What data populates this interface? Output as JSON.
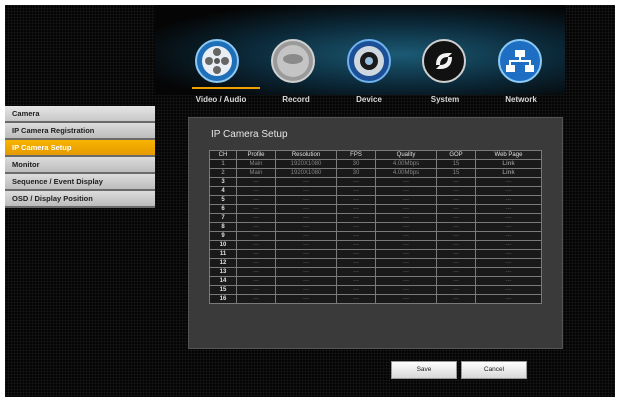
{
  "nav": {
    "tabs": [
      {
        "label": "Video / Audio",
        "icon": "film-reel-icon",
        "active": true
      },
      {
        "label": "Record",
        "icon": "record-disc-icon"
      },
      {
        "label": "Device",
        "icon": "device-dial-icon"
      },
      {
        "label": "System",
        "icon": "system-swirl-icon"
      },
      {
        "label": "Network",
        "icon": "network-icon"
      }
    ]
  },
  "sidebar": {
    "items": [
      {
        "label": "Camera"
      },
      {
        "label": "IP Camera Registration"
      },
      {
        "label": "IP Camera Setup",
        "active": true
      },
      {
        "label": "Monitor"
      },
      {
        "label": "Sequence / Event Display"
      },
      {
        "label": "OSD / Display Position"
      }
    ]
  },
  "panel": {
    "title": "IP Camera Setup",
    "columns": [
      "CH",
      "Profile",
      "Resolution",
      "FPS",
      "Quality",
      "GOP",
      "Web Page"
    ],
    "rows": [
      [
        "1",
        "Main",
        "1920X1080",
        "30",
        "4.00Mbps",
        "15",
        "Link"
      ],
      [
        "2",
        "Main",
        "1920X1080",
        "30",
        "4.00Mbps",
        "15",
        "Link"
      ],
      [
        "3",
        "---",
        "---",
        "---",
        "---",
        "---",
        "---"
      ],
      [
        "4",
        "---",
        "---",
        "---",
        "---",
        "---",
        "---"
      ],
      [
        "5",
        "---",
        "---",
        "---",
        "---",
        "---",
        "---"
      ],
      [
        "6",
        "---",
        "---",
        "---",
        "---",
        "---",
        "---"
      ],
      [
        "7",
        "---",
        "---",
        "---",
        "---",
        "---",
        "---"
      ],
      [
        "8",
        "---",
        "---",
        "---",
        "---",
        "---",
        "---"
      ],
      [
        "9",
        "---",
        "---",
        "---",
        "---",
        "---",
        "---"
      ],
      [
        "10",
        "---",
        "---",
        "---",
        "---",
        "---",
        "---"
      ],
      [
        "11",
        "---",
        "---",
        "---",
        "---",
        "---",
        "---"
      ],
      [
        "12",
        "---",
        "---",
        "---",
        "---",
        "---",
        "---"
      ],
      [
        "13",
        "---",
        "---",
        "---",
        "---",
        "---",
        "---"
      ],
      [
        "14",
        "---",
        "---",
        "---",
        "---",
        "---",
        "---"
      ],
      [
        "15",
        "---",
        "---",
        "---",
        "---",
        "---",
        "---"
      ],
      [
        "16",
        "---",
        "---",
        "---",
        "---",
        "---",
        "---"
      ]
    ]
  },
  "buttons": {
    "save": "Save",
    "cancel": "Cancel"
  },
  "colors": {
    "accent": "#f0a000",
    "background": "#050505",
    "panel": "#3a3a3a"
  }
}
